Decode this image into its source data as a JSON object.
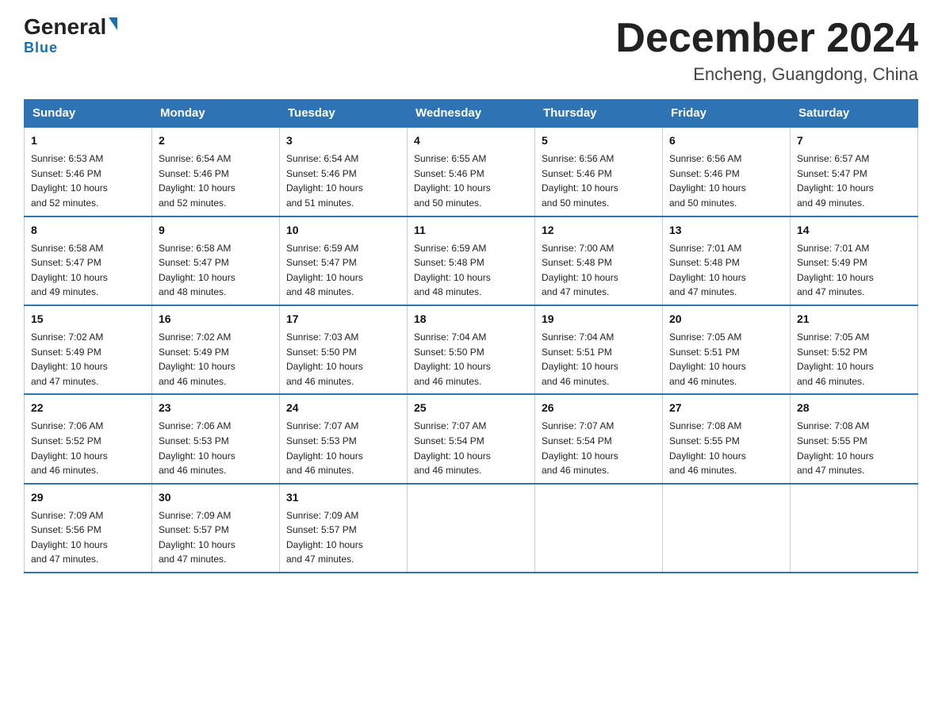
{
  "logo": {
    "general": "General",
    "blue": "Blue",
    "tagline": "Blue"
  },
  "header": {
    "month": "December 2024",
    "location": "Encheng, Guangdong, China"
  },
  "days_of_week": [
    "Sunday",
    "Monday",
    "Tuesday",
    "Wednesday",
    "Thursday",
    "Friday",
    "Saturday"
  ],
  "weeks": [
    [
      {
        "day": "1",
        "sunrise": "6:53 AM",
        "sunset": "5:46 PM",
        "daylight": "10 hours and 52 minutes."
      },
      {
        "day": "2",
        "sunrise": "6:54 AM",
        "sunset": "5:46 PM",
        "daylight": "10 hours and 52 minutes."
      },
      {
        "day": "3",
        "sunrise": "6:54 AM",
        "sunset": "5:46 PM",
        "daylight": "10 hours and 51 minutes."
      },
      {
        "day": "4",
        "sunrise": "6:55 AM",
        "sunset": "5:46 PM",
        "daylight": "10 hours and 50 minutes."
      },
      {
        "day": "5",
        "sunrise": "6:56 AM",
        "sunset": "5:46 PM",
        "daylight": "10 hours and 50 minutes."
      },
      {
        "day": "6",
        "sunrise": "6:56 AM",
        "sunset": "5:46 PM",
        "daylight": "10 hours and 50 minutes."
      },
      {
        "day": "7",
        "sunrise": "6:57 AM",
        "sunset": "5:47 PM",
        "daylight": "10 hours and 49 minutes."
      }
    ],
    [
      {
        "day": "8",
        "sunrise": "6:58 AM",
        "sunset": "5:47 PM",
        "daylight": "10 hours and 49 minutes."
      },
      {
        "day": "9",
        "sunrise": "6:58 AM",
        "sunset": "5:47 PM",
        "daylight": "10 hours and 48 minutes."
      },
      {
        "day": "10",
        "sunrise": "6:59 AM",
        "sunset": "5:47 PM",
        "daylight": "10 hours and 48 minutes."
      },
      {
        "day": "11",
        "sunrise": "6:59 AM",
        "sunset": "5:48 PM",
        "daylight": "10 hours and 48 minutes."
      },
      {
        "day": "12",
        "sunrise": "7:00 AM",
        "sunset": "5:48 PM",
        "daylight": "10 hours and 47 minutes."
      },
      {
        "day": "13",
        "sunrise": "7:01 AM",
        "sunset": "5:48 PM",
        "daylight": "10 hours and 47 minutes."
      },
      {
        "day": "14",
        "sunrise": "7:01 AM",
        "sunset": "5:49 PM",
        "daylight": "10 hours and 47 minutes."
      }
    ],
    [
      {
        "day": "15",
        "sunrise": "7:02 AM",
        "sunset": "5:49 PM",
        "daylight": "10 hours and 47 minutes."
      },
      {
        "day": "16",
        "sunrise": "7:02 AM",
        "sunset": "5:49 PM",
        "daylight": "10 hours and 46 minutes."
      },
      {
        "day": "17",
        "sunrise": "7:03 AM",
        "sunset": "5:50 PM",
        "daylight": "10 hours and 46 minutes."
      },
      {
        "day": "18",
        "sunrise": "7:04 AM",
        "sunset": "5:50 PM",
        "daylight": "10 hours and 46 minutes."
      },
      {
        "day": "19",
        "sunrise": "7:04 AM",
        "sunset": "5:51 PM",
        "daylight": "10 hours and 46 minutes."
      },
      {
        "day": "20",
        "sunrise": "7:05 AM",
        "sunset": "5:51 PM",
        "daylight": "10 hours and 46 minutes."
      },
      {
        "day": "21",
        "sunrise": "7:05 AM",
        "sunset": "5:52 PM",
        "daylight": "10 hours and 46 minutes."
      }
    ],
    [
      {
        "day": "22",
        "sunrise": "7:06 AM",
        "sunset": "5:52 PM",
        "daylight": "10 hours and 46 minutes."
      },
      {
        "day": "23",
        "sunrise": "7:06 AM",
        "sunset": "5:53 PM",
        "daylight": "10 hours and 46 minutes."
      },
      {
        "day": "24",
        "sunrise": "7:07 AM",
        "sunset": "5:53 PM",
        "daylight": "10 hours and 46 minutes."
      },
      {
        "day": "25",
        "sunrise": "7:07 AM",
        "sunset": "5:54 PM",
        "daylight": "10 hours and 46 minutes."
      },
      {
        "day": "26",
        "sunrise": "7:07 AM",
        "sunset": "5:54 PM",
        "daylight": "10 hours and 46 minutes."
      },
      {
        "day": "27",
        "sunrise": "7:08 AM",
        "sunset": "5:55 PM",
        "daylight": "10 hours and 46 minutes."
      },
      {
        "day": "28",
        "sunrise": "7:08 AM",
        "sunset": "5:55 PM",
        "daylight": "10 hours and 47 minutes."
      }
    ],
    [
      {
        "day": "29",
        "sunrise": "7:09 AM",
        "sunset": "5:56 PM",
        "daylight": "10 hours and 47 minutes."
      },
      {
        "day": "30",
        "sunrise": "7:09 AM",
        "sunset": "5:57 PM",
        "daylight": "10 hours and 47 minutes."
      },
      {
        "day": "31",
        "sunrise": "7:09 AM",
        "sunset": "5:57 PM",
        "daylight": "10 hours and 47 minutes."
      },
      null,
      null,
      null,
      null
    ]
  ],
  "labels": {
    "sunrise": "Sunrise:",
    "sunset": "Sunset:",
    "daylight": "Daylight:"
  }
}
